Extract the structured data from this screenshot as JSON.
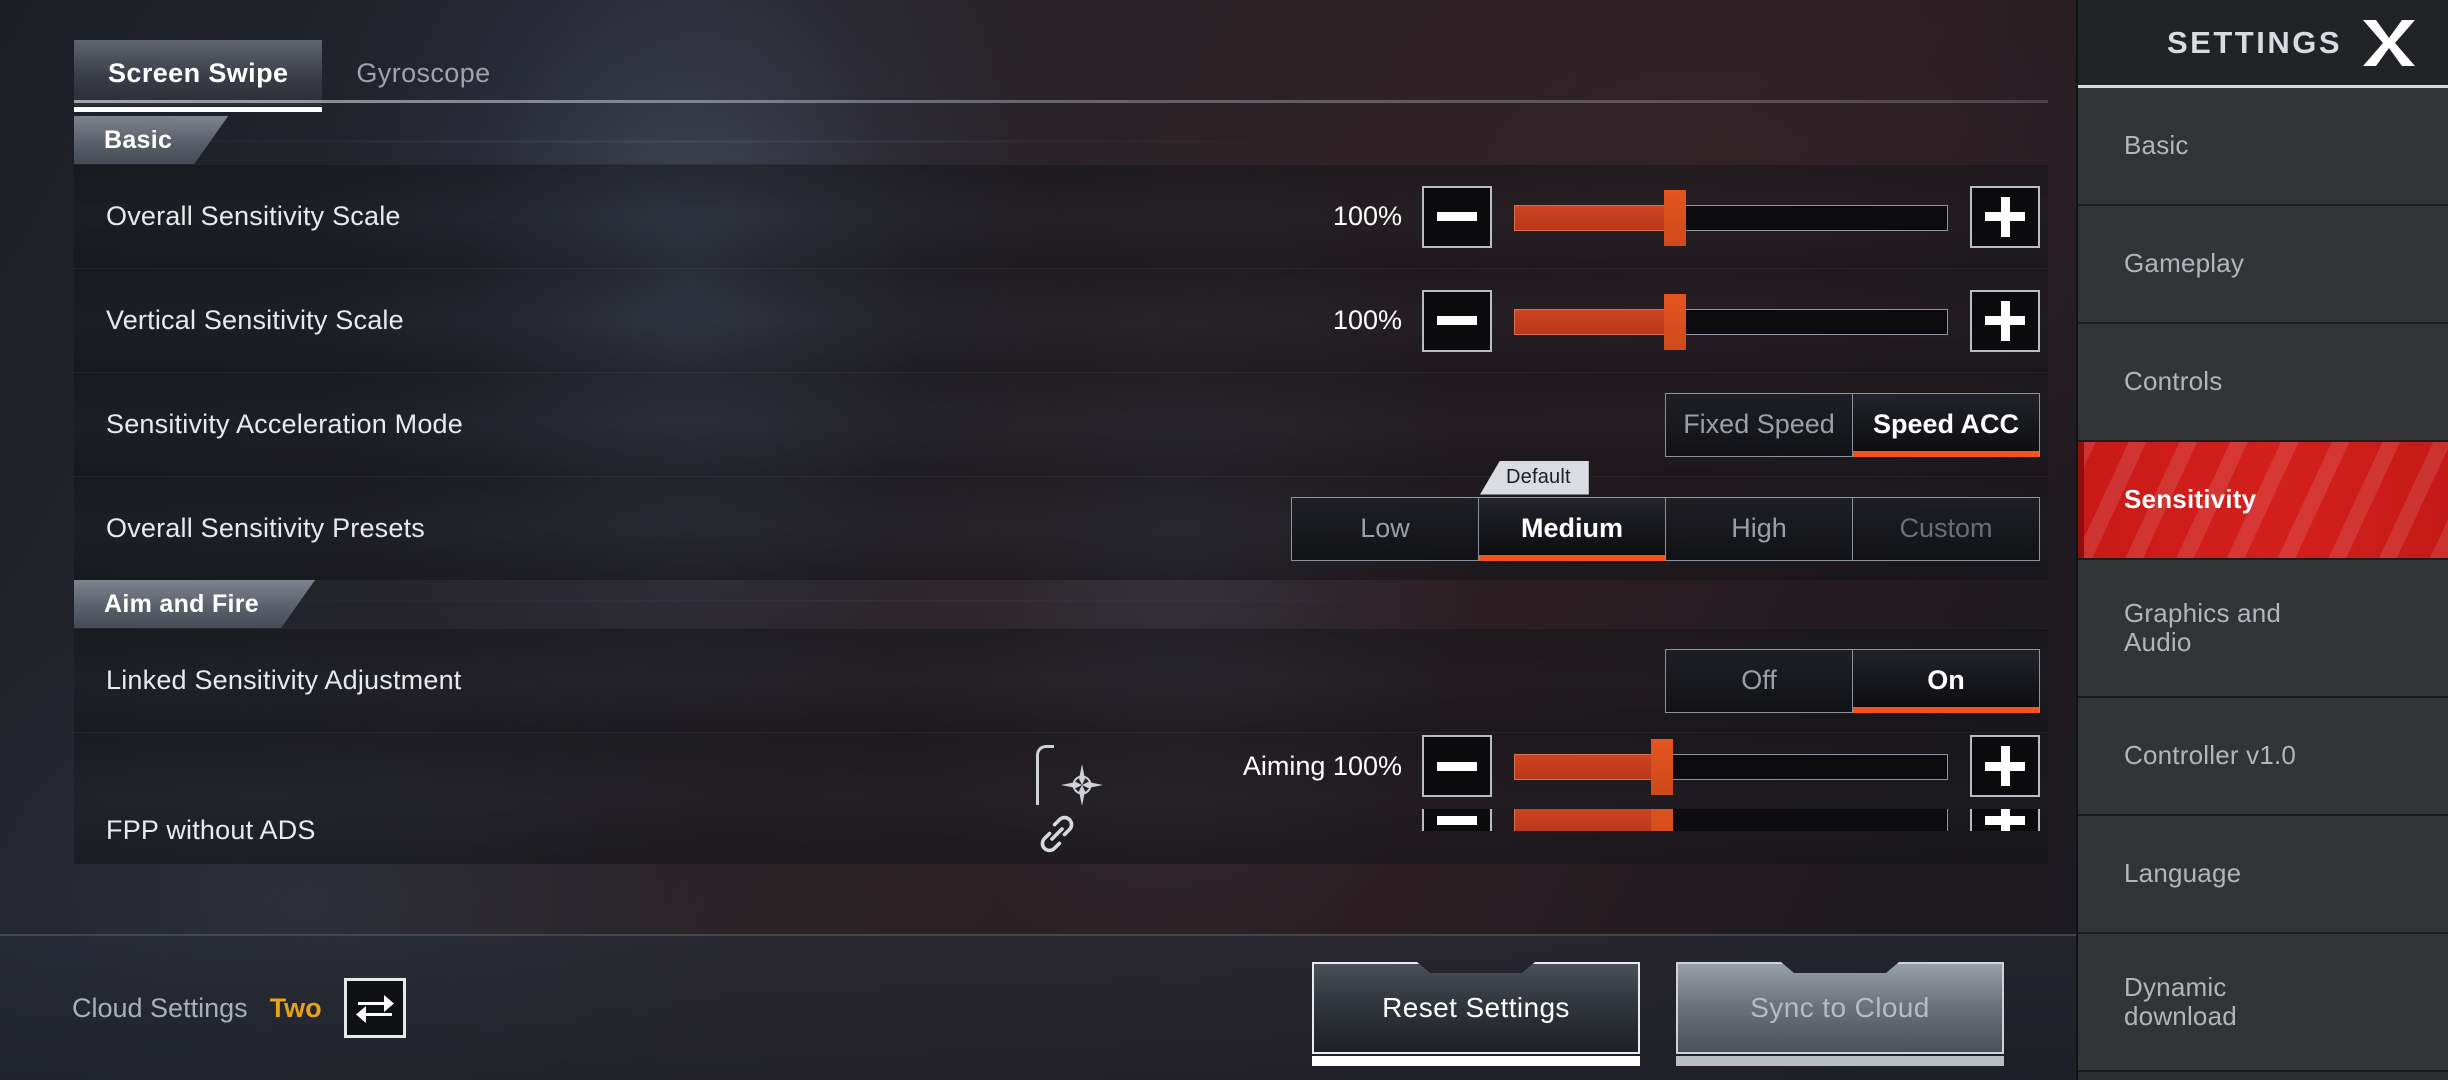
{
  "tabs": [
    {
      "label": "Screen Swipe",
      "active": true
    },
    {
      "label": "Gyroscope",
      "active": false
    }
  ],
  "sections": {
    "basic": "Basic",
    "aim_and_fire": "Aim and Fire"
  },
  "rows": {
    "overall_sensitivity_scale": {
      "label": "Overall Sensitivity Scale",
      "value": "100%",
      "minus": "–",
      "plus": "+",
      "fill_percent": 37
    },
    "vertical_sensitivity_scale": {
      "label": "Vertical Sensitivity Scale",
      "value": "100%",
      "minus": "–",
      "plus": "+",
      "fill_percent": 37
    },
    "sensitivity_acceleration_mode": {
      "label": "Sensitivity Acceleration Mode",
      "options": [
        {
          "label": "Fixed Speed",
          "selected": false
        },
        {
          "label": "Speed ACC",
          "selected": true
        }
      ]
    },
    "overall_sensitivity_presets": {
      "label": "Overall Sensitivity Presets",
      "tooltip": "Default",
      "options": [
        {
          "label": "Low",
          "selected": false,
          "disabled": false
        },
        {
          "label": "Medium",
          "selected": true,
          "disabled": false
        },
        {
          "label": "High",
          "selected": false,
          "disabled": false
        },
        {
          "label": "Custom",
          "selected": false,
          "disabled": true
        }
      ]
    },
    "linked_sensitivity_adjustment": {
      "label": "Linked Sensitivity Adjustment",
      "options": [
        {
          "label": "Off",
          "selected": false
        },
        {
          "label": "On",
          "selected": true
        }
      ]
    },
    "fpp_without_ads": {
      "label": "FPP without ADS",
      "value": "Aiming 100%",
      "minus": "–",
      "plus": "+",
      "fill_percent": 34
    }
  },
  "bottom_bar": {
    "cloud_settings_label": "Cloud Settings",
    "cloud_settings_value": "Two",
    "reset_button": "Reset Settings",
    "sync_button": "Sync to Cloud"
  },
  "sidebar": {
    "title": "SETTINGS",
    "items": [
      {
        "label": "Basic",
        "active": false
      },
      {
        "label": "Gameplay",
        "active": false
      },
      {
        "label": "Controls",
        "active": false
      },
      {
        "label": "Sensitivity",
        "active": true
      },
      {
        "label": "Graphics and Audio",
        "active": false
      },
      {
        "label": "Controller v1.0",
        "active": false
      },
      {
        "label": "Language",
        "active": false
      },
      {
        "label": "Dynamic download",
        "active": false
      }
    ]
  },
  "colors": {
    "accent_orange": "#f2541c",
    "slider_red": "#cf4422",
    "sidebar_active_red": "#c81a18",
    "cloud_value_gold": "#e8a21c",
    "text_primary": "#ffffff",
    "text_muted": "#9aa0a8"
  }
}
